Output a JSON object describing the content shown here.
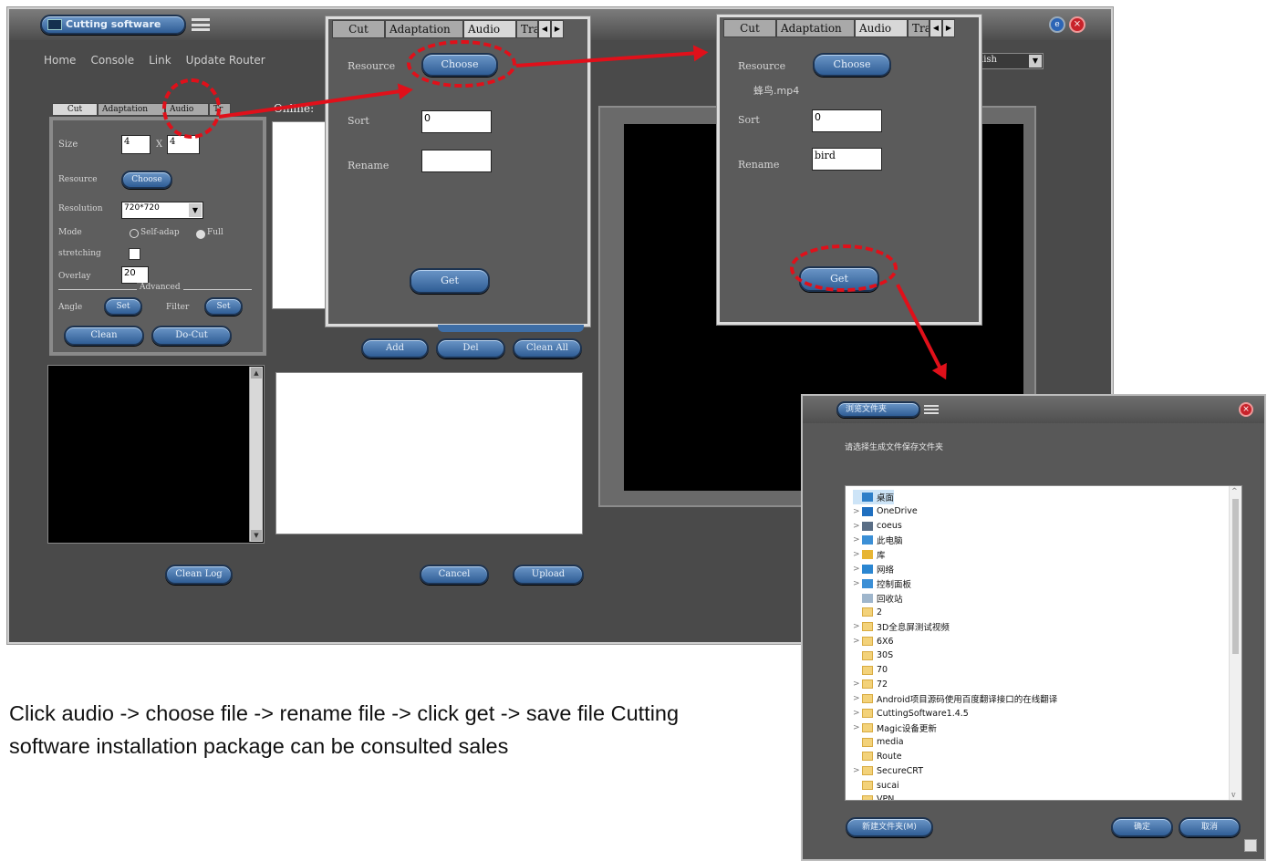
{
  "main_window": {
    "title": "Cutting software",
    "menu": [
      "Home",
      "Console",
      "Link",
      "Update Router"
    ],
    "lang_select": "lish",
    "online_label": "Online:",
    "tabs": [
      "Cut",
      "Adaptation",
      "Audio",
      "Tr"
    ],
    "cut_panel": {
      "size_label": "Size",
      "size_w": "4",
      "size_x": "X",
      "size_h": "4",
      "resource_label": "Resource",
      "choose": "Choose",
      "resolution_label": "Resolution",
      "resolution_value": "720*720",
      "mode_label": "Mode",
      "mode_self": "Self-adap",
      "mode_full": "Full",
      "stretching_label": "stretching",
      "overlay_label": "Overlay",
      "overlay_value": "20",
      "advanced": "Advanced",
      "angle_label": "Angle",
      "angle_set": "Set",
      "filter_label": "Filter",
      "filter_set": "Set",
      "clean": "Clean",
      "do_cut": "Do-Cut"
    },
    "add": "Add",
    "del": "Del",
    "clean_all": "Clean All",
    "clean_log": "Clean Log",
    "cancel": "Cancel",
    "upload": "Upload"
  },
  "popup1": {
    "tabs": [
      "Cut",
      "Adaptation",
      "Audio",
      "Tra"
    ],
    "resource_label": "Resource",
    "choose": "Choose",
    "sort_label": "Sort",
    "sort_value": "0",
    "rename_label": "Rename",
    "rename_value": "",
    "get": "Get"
  },
  "popup2": {
    "tabs": [
      "Cut",
      "Adaptation",
      "Audio",
      "Tra"
    ],
    "resource_label": "Resource",
    "choose": "Choose",
    "file_name": "蜂鸟.mp4",
    "sort_label": "Sort",
    "sort_value": "0",
    "rename_label": "Rename",
    "rename_value": "bird",
    "get": "Get"
  },
  "folder_dialog": {
    "title": "浏览文件夹",
    "prompt": "请选择生成文件保存文件夹",
    "tree": [
      {
        "label": "桌面",
        "chev": "",
        "icon": "desktop"
      },
      {
        "label": "OneDrive",
        "chev": ">",
        "icon": "cloud"
      },
      {
        "label": "coeus",
        "chev": ">",
        "icon": "user"
      },
      {
        "label": "此电脑",
        "chev": ">",
        "icon": "pc"
      },
      {
        "label": "库",
        "chev": ">",
        "icon": "library"
      },
      {
        "label": "网络",
        "chev": ">",
        "icon": "network"
      },
      {
        "label": "控制面板",
        "chev": ">",
        "icon": "control"
      },
      {
        "label": "回收站",
        "chev": "",
        "icon": "recycle"
      },
      {
        "label": "2",
        "chev": "",
        "icon": "folder"
      },
      {
        "label": "3D全息屏测试视频",
        "chev": ">",
        "icon": "folder"
      },
      {
        "label": "6X6",
        "chev": ">",
        "icon": "folder"
      },
      {
        "label": "30S",
        "chev": "",
        "icon": "folder"
      },
      {
        "label": "70",
        "chev": "",
        "icon": "folder"
      },
      {
        "label": "72",
        "chev": ">",
        "icon": "folder"
      },
      {
        "label": "Android项目源码使用百度翻译接口的在线翻译",
        "chev": ">",
        "icon": "folder"
      },
      {
        "label": "CuttingSoftware1.4.5",
        "chev": ">",
        "icon": "folder"
      },
      {
        "label": "Magic设备更新",
        "chev": ">",
        "icon": "folder"
      },
      {
        "label": "media",
        "chev": "",
        "icon": "folder"
      },
      {
        "label": "Route",
        "chev": "",
        "icon": "folder"
      },
      {
        "label": "SecureCRT",
        "chev": ">",
        "icon": "folder"
      },
      {
        "label": "sucai",
        "chev": "",
        "icon": "folder"
      },
      {
        "label": "VPN",
        "chev": "",
        "icon": "folder"
      }
    ],
    "new_folder": "新建文件夹(M)",
    "ok": "确定",
    "cancel": "取消"
  },
  "caption": "Click audio -> choose file -> rename file -> click get -> save file Cutting software installation package can be consulted sales",
  "colors": {
    "annotation": "#e0101a",
    "button_blue": "#3e6ea6",
    "window_gray": "#5b5b5b"
  }
}
